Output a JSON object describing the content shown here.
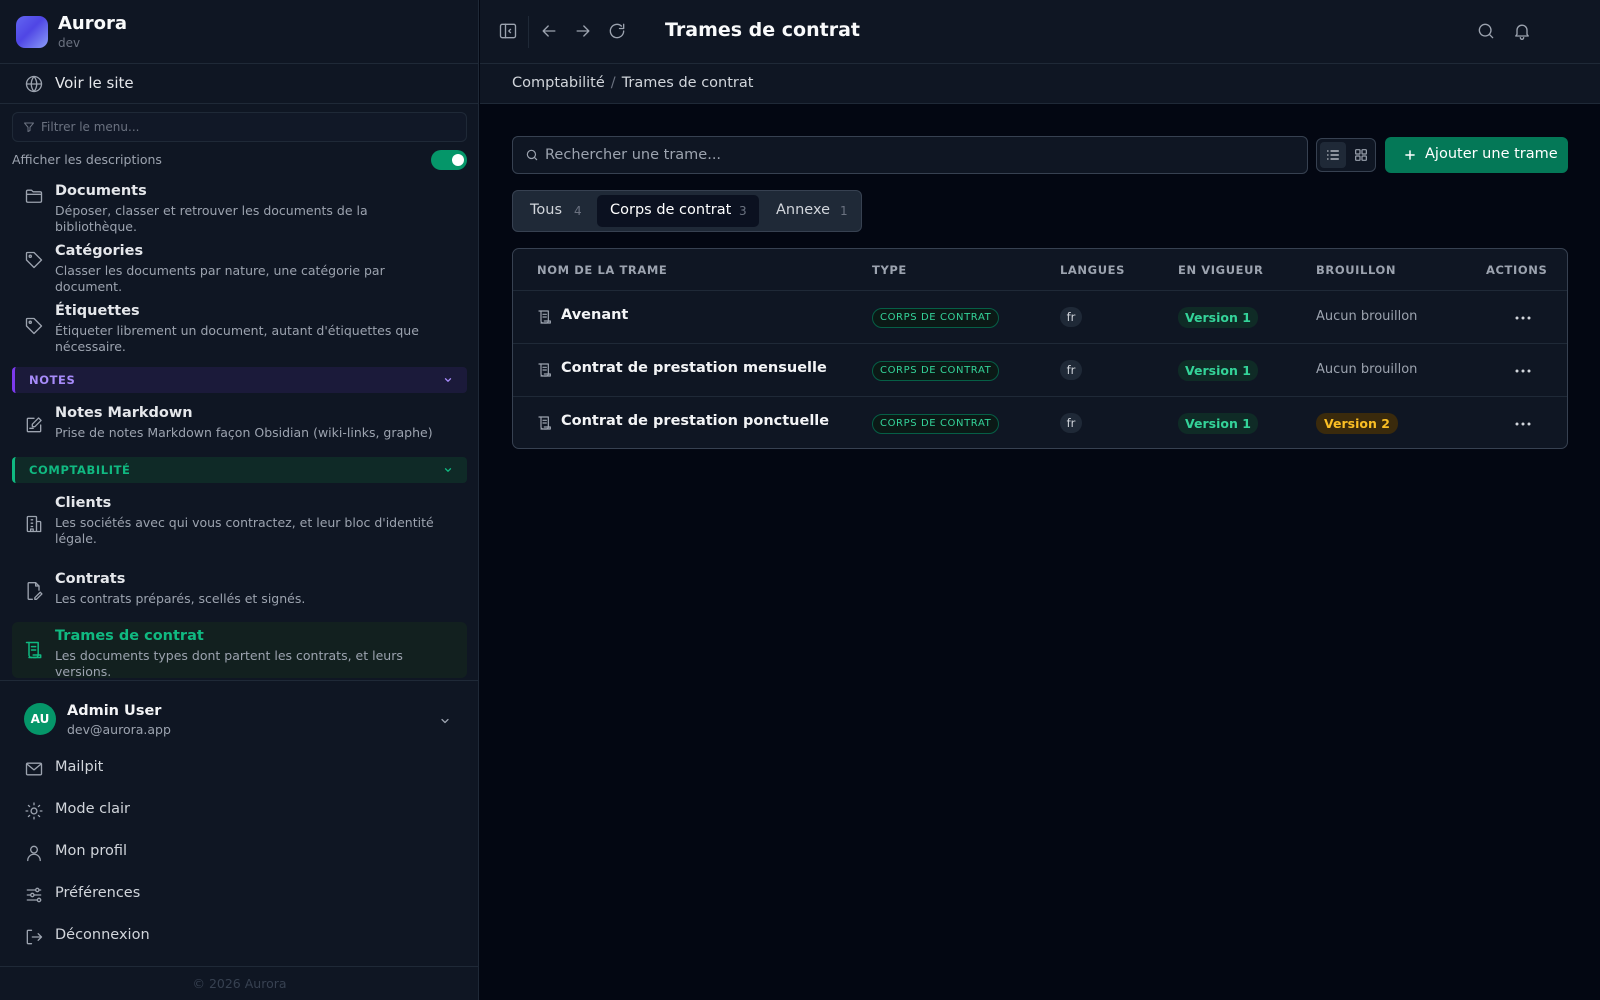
{
  "app": {
    "name": "Aurora",
    "env": "dev"
  },
  "sidebar": {
    "view_site": "Voir le site",
    "filter_placeholder": "Filtrer le menu...",
    "show_descriptions": "Afficher les descriptions",
    "show_descriptions_on": true,
    "items": [
      {
        "title": "Documents",
        "desc": "Déposer, classer et retrouver les documents de la bibliothèque.",
        "icon": "folder-icon"
      },
      {
        "title": "Catégories",
        "desc": "Classer les documents par nature, une catégorie par document.",
        "icon": "tag-icon"
      },
      {
        "title": "Étiquettes",
        "desc": "Étiqueter librement un document, autant d'étiquettes que nécessaire.",
        "icon": "label-icon"
      }
    ],
    "sections": {
      "notes": {
        "label": "NOTES",
        "color": "#a78bfa",
        "items": [
          {
            "title": "Notes Markdown",
            "desc": "Prise de notes Markdown façon Obsidian (wiki-links, graphe)",
            "icon": "note-edit-icon"
          }
        ]
      },
      "compta": {
        "label": "COMPTABILITÉ",
        "color": "#10b981",
        "items": [
          {
            "title": "Clients",
            "desc": "Les sociétés avec qui vous contractez, et leur bloc d'identité légale.",
            "icon": "building-icon"
          },
          {
            "title": "Contrats",
            "desc": "Les contrats préparés, scellés et signés.",
            "icon": "contract-icon"
          },
          {
            "title": "Trames de contrat",
            "desc": "Les documents types dont partent les contrats, et leurs versions.",
            "icon": "scroll-icon",
            "active": true
          }
        ]
      }
    },
    "user": {
      "initials": "AU",
      "name": "Admin User",
      "email": "dev@aurora.app"
    },
    "bottom": [
      {
        "label": "Mailpit",
        "icon": "mail-icon"
      },
      {
        "label": "Mode clair",
        "icon": "sun-icon"
      },
      {
        "label": "Mon profil",
        "icon": "user-icon"
      },
      {
        "label": "Préférences",
        "icon": "sliders-icon"
      },
      {
        "label": "Déconnexion",
        "icon": "logout-icon"
      }
    ],
    "footer": "© 2026 Aurora"
  },
  "topbar": {
    "title": "Trames de contrat"
  },
  "breadcrumb": [
    "Comptabilité",
    "Trames de contrat"
  ],
  "toolbar": {
    "search_placeholder": "Rechercher une trame...",
    "add_label": "Ajouter une trame",
    "view_mode": "list"
  },
  "tabs": [
    {
      "label": "Tous",
      "count": "4"
    },
    {
      "label": "Corps de contrat",
      "count": "3",
      "active": true
    },
    {
      "label": "Annexe",
      "count": "1"
    }
  ],
  "table": {
    "headers": [
      "NOM DE LA TRAME",
      "TYPE",
      "LANGUES",
      "EN VIGUEUR",
      "BROUILLON",
      "ACTIONS"
    ],
    "rows": [
      {
        "name": "Avenant",
        "type": "CORPS DE CONTRAT",
        "lang": "fr",
        "version": "Version 1",
        "draft": "Aucun brouillon",
        "draft_is_version": false
      },
      {
        "name": "Contrat de prestation mensuelle",
        "type": "CORPS DE CONTRAT",
        "lang": "fr",
        "version": "Version 1",
        "draft": "Aucun brouillon",
        "draft_is_version": false
      },
      {
        "name": "Contrat de prestation ponctuelle",
        "type": "CORPS DE CONTRAT",
        "lang": "fr",
        "version": "Version 1",
        "draft": "Version 2",
        "draft_is_version": true
      }
    ]
  },
  "colors": {
    "accent": "#10b981",
    "primary_button": "#047857",
    "notes_accent": "#7c3aed",
    "draft_warning": "#fbbf24"
  }
}
